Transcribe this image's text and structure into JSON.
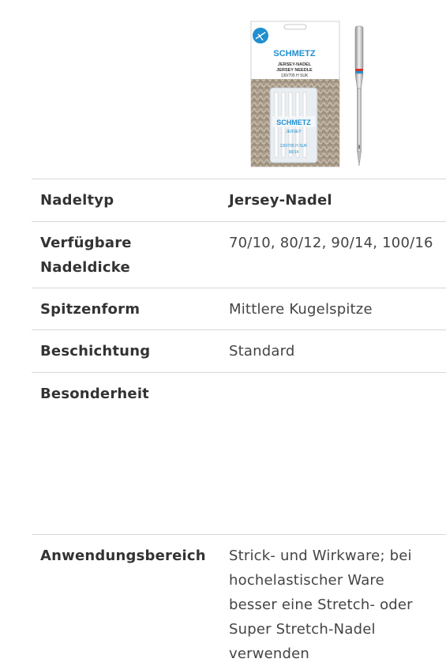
{
  "package": {
    "brand": "SCHMETZ",
    "title_de": "JERSEY-NADEL",
    "title_en": "JERSEY NEEDLE",
    "system": "130/705 H SUK",
    "case_brand": "SCHMETZ",
    "case_type": "JERSEY",
    "case_system": "130/705 H SUK",
    "case_size": "90/14"
  },
  "specs": [
    {
      "label": "Nadeltyp",
      "value": "Jersey-Nadel"
    },
    {
      "label": "Verfügbare Nadeldicke",
      "value": "70/10, 80/12, 90/14, 100/16"
    },
    {
      "label": "Spitzenform",
      "value": "Mittlere Kugelspitze"
    },
    {
      "label": "Beschichtung",
      "value": "Standard"
    },
    {
      "label": "Besonderheit",
      "value": ""
    },
    {
      "label": "Anwendungsbereich",
      "value": "Strick- und Wirkware; bei hochelastischer Ware besser eine Stretch- oder Super Stretch-Nadel verwenden"
    }
  ],
  "colors": {
    "brand_blue": "#1f8fd0",
    "divider": "#d7d7d7",
    "text": "#333333"
  }
}
